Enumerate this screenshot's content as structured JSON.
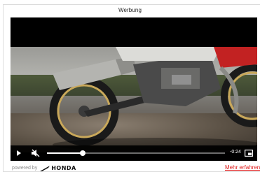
{
  "ad": {
    "label": "Werbung",
    "powered_by": "powered by",
    "brand": "HONDA",
    "learn_more": "Mehr erfahren"
  },
  "player": {
    "time_remaining": "-0:24",
    "progress": 0.2,
    "icons": {
      "play": "play-icon",
      "mute": "speaker-muted-icon",
      "fullscreen": "fullscreen-icon"
    }
  },
  "colors": {
    "accent_link": "#e01b1b",
    "player_bg": "#000000",
    "track": "#6c6c6c"
  }
}
